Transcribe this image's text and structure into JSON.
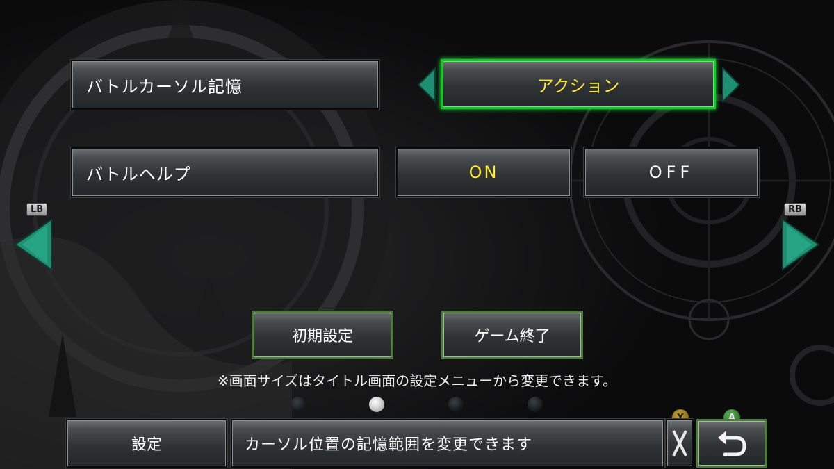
{
  "settings": {
    "row1": {
      "label": "バトルカーソル記憶",
      "value": "アクション"
    },
    "row2": {
      "label": "バトルヘルプ",
      "on": "ON",
      "off": "OFF"
    }
  },
  "nav": {
    "lb": "LB",
    "rb": "RB"
  },
  "buttons": {
    "reset": "初期設定",
    "quit": "ゲーム終了"
  },
  "note": "※画面サイズはタイトル画面の設定メニューから変更できます。",
  "pagination": {
    "current": 2,
    "total": 4
  },
  "footer": {
    "section": "設定",
    "help": "カーソル位置の記憶範囲を変更できます",
    "y_badge": "Y",
    "a_badge": "A"
  },
  "colors": {
    "accent": "#17c42a",
    "arrow": "#1e8f72",
    "highlight": "#ffea35"
  },
  "icons": {
    "left": "triangle-left-icon",
    "right": "triangle-right-icon",
    "back": "return-arrow-icon",
    "x": "x-icon"
  }
}
